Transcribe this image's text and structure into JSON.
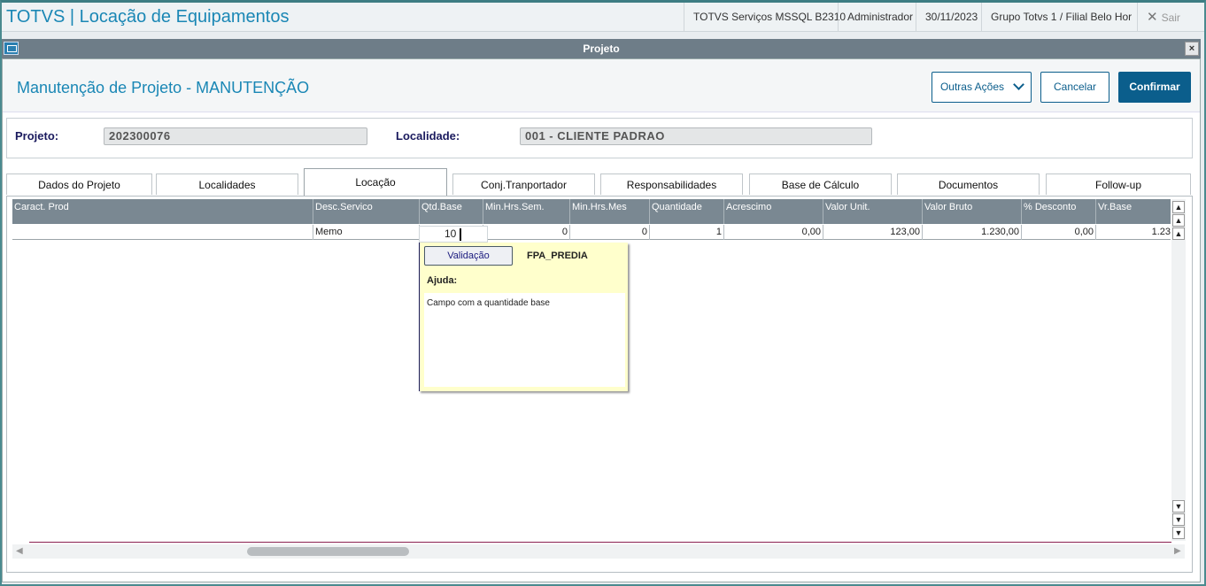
{
  "app": {
    "title": "TOTVS | Locação de Equipamentos",
    "environment": "TOTVS Serviços MSSQL B2310",
    "user": "Administrador",
    "date": "30/11/2023",
    "branch": "Grupo Totvs 1 / Filial Belo Hor",
    "exit_label": "Sair"
  },
  "dialog": {
    "title": "Projeto",
    "close_label": "×",
    "page_title": "Manutenção de Projeto - MANUTENÇÃO",
    "buttons": {
      "other_actions": "Outras Ações",
      "cancel": "Cancelar",
      "confirm": "Confirmar"
    }
  },
  "project": {
    "project_label": "Projeto:",
    "project_value": "202300076",
    "location_label": "Localidade:",
    "location_value": "001 - CLIENTE PADRAO"
  },
  "tabs": [
    {
      "label": "Dados do Projeto",
      "active": false
    },
    {
      "label": "Localidades",
      "active": false
    },
    {
      "label": "Locação",
      "active": true
    },
    {
      "label": "Conj.Tranportador",
      "active": false
    },
    {
      "label": "Responsabilidades",
      "active": false
    },
    {
      "label": "Base de Cálculo",
      "active": false
    },
    {
      "label": "Documentos",
      "active": false
    },
    {
      "label": "Follow-up",
      "active": false
    }
  ],
  "grid": {
    "columns": [
      "Caract. Prod",
      "Desc.Servico",
      "Qtd.Base",
      "Min.Hrs.Sem.",
      "Min.Hrs.Mes",
      "Quantidade",
      "Acrescimo",
      "Valor Unit.",
      "Valor Bruto",
      "% Desconto",
      "Vr.Base"
    ],
    "row": [
      "",
      "Memo",
      "10",
      "0",
      "0",
      "1",
      "0,00",
      "123,00",
      "1.230,00",
      "0,00",
      "1.23"
    ]
  },
  "help_popup": {
    "validate_label": "Validação",
    "field_code": "FPA_PREDIA",
    "help_label": "Ajuda:",
    "help_text": "Campo com a quantidade base"
  }
}
